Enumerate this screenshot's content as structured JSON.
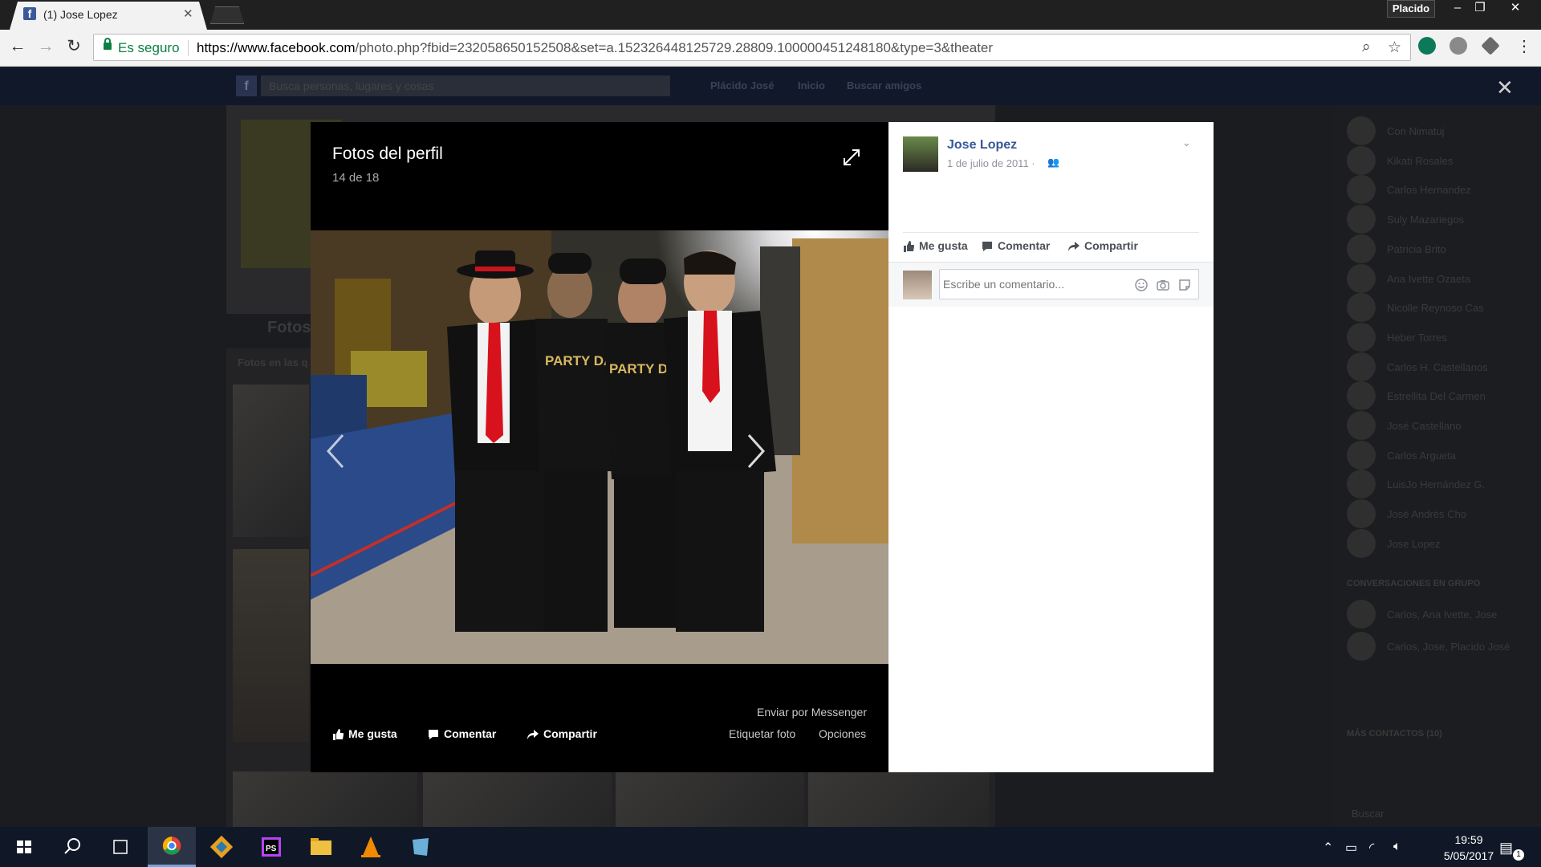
{
  "browser": {
    "tab_title": "(1) Jose Lopez",
    "tab_favicon_letter": "f",
    "profile_name": "Placido",
    "secure_label": "Es seguro",
    "url_host": "https://www.facebook.com",
    "url_path": "/photo.php?fbid=232058650152508&set=a.152326448125729.28809.100000451248180&type=3&theater"
  },
  "facebook": {
    "search_placeholder": "Busca personas, lugares y cosas",
    "nav": [
      "Plácido José",
      "Inicio",
      "Buscar amigos"
    ],
    "bg_section_title": "Fotos",
    "bg_section_sub": "Fotos en las q"
  },
  "chat": {
    "contacts": [
      "Con Nimatuj",
      "Kikati Rosales",
      "Carlos Hernandez",
      "Suly Mazariegos",
      "Patricia Brito",
      "Ana Ivette Ozaeta",
      "Nicolle Reynoso Cas",
      "Heber Torres",
      "Carlos H. Castellanos",
      "Estrellita Del Carmen",
      "José Castellano",
      "Carlos Argueta",
      "LuisJo Hernández G.",
      "José Andrés Cho",
      "Jose Lopez"
    ],
    "group_heading": "CONVERSACIONES EN GRUPO",
    "groups": [
      "Carlos, Ana Ivette, Jose",
      "Carlos, Jose, Placido José"
    ],
    "more_heading": "MÁS CONTACTOS (10)",
    "search_placeholder": "Buscar"
  },
  "theater": {
    "album_title": "Fotos del perfil",
    "photo_counter": "14 de 18",
    "photo_alt": "Cuatro jóvenes posando en un gimnasio; dos llevan camisetas 'Party Dancers'",
    "shirt_text": "PARTY DANCERS",
    "actions": {
      "like": "Me gusta",
      "comment": "Comentar",
      "share": "Compartir",
      "send_messenger": "Enviar por Messenger",
      "tag_photo": "Etiquetar foto",
      "options": "Opciones"
    }
  },
  "info_pane": {
    "author": "Jose Lopez",
    "date": "1 de julio de 2011",
    "date_separator": "·",
    "actions": {
      "like": "Me gusta",
      "comment": "Comentar",
      "share": "Compartir"
    },
    "comment_placeholder": "Escribe un comentario..."
  },
  "taskbar": {
    "time": "19:59",
    "date": "5/05/2017",
    "notification_count": "1"
  },
  "colors": {
    "facebook_blue": "#365899",
    "secure_green": "#0b8043",
    "photo_tie_red": "#d8121c"
  }
}
